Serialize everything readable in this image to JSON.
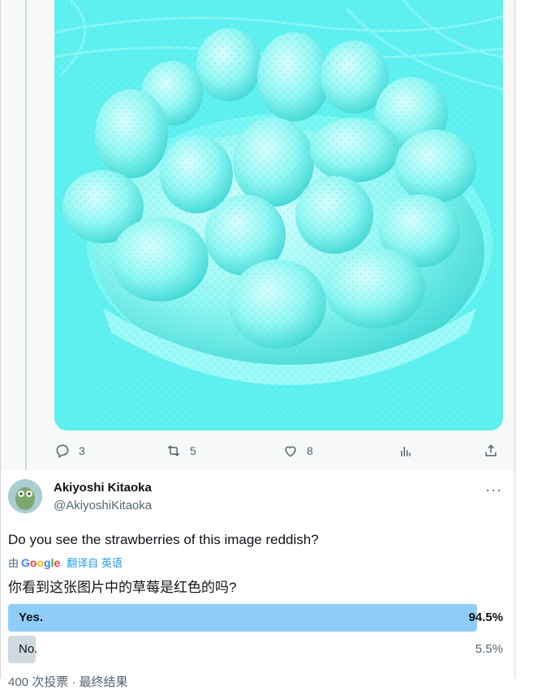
{
  "first_tweet": {
    "image_alt": "cyan strawberries on a tart",
    "actions": {
      "reply_count": "3",
      "retweet_count": "5",
      "like_count": "8"
    }
  },
  "second_tweet": {
    "display_name": "Akiyoshi Kitaoka",
    "handle": "@AkiyoshiKitaoka",
    "more": "···",
    "text_en": "Do you see the strawberries of this image reddish?",
    "translate_prefix": "由",
    "google_letters": [
      "G",
      "o",
      "o",
      "g",
      "l",
      "e"
    ],
    "translate_link": "翻译自 英语",
    "text_zh": "你看到这张图片中的草莓是红色的吗?",
    "poll": {
      "options": [
        {
          "label": "Yes.",
          "percent": "94.5%",
          "fraction": 0.945
        },
        {
          "label": "No.",
          "percent": "5.5%",
          "fraction": 0.055
        }
      ],
      "footer": "400 次投票 · 最终结果"
    }
  },
  "colors": {
    "leading_bar": "#8ecdf8",
    "other_bar": "#cfd9de",
    "link": "#1d9bf0"
  }
}
